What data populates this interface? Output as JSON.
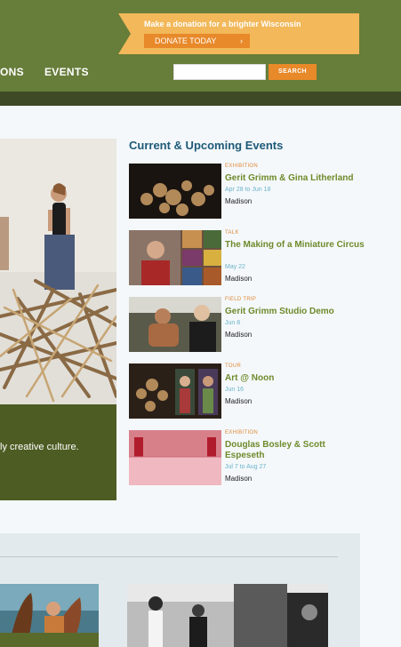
{
  "nav": {
    "items": [
      {
        "label": "ONS"
      },
      {
        "label": "EVENTS"
      }
    ]
  },
  "donate": {
    "message": "Make a donation for a brighter Wisconsin",
    "button_label": "DONATE TODAY",
    "chevron": "›"
  },
  "search": {
    "value": "",
    "button_label": "SEARCH"
  },
  "hero": {
    "caption": "ly creative culture."
  },
  "events_section": {
    "title": "Current & Upcoming Events",
    "items": [
      {
        "type": "EXHIBITION",
        "title": "Gerit Grimm & Gina Litherland",
        "date": "Apr 28 to Jun 18",
        "location": "Madison"
      },
      {
        "type": "TALK",
        "title": "The Making of a Miniature Circus",
        "date": "May 22",
        "location": "Madison"
      },
      {
        "type": "FIELD TRIP",
        "title": "Gerit Grimm Studio Demo",
        "date": "Jun 8",
        "location": "Madison"
      },
      {
        "type": "TOUR",
        "title": "Art @ Noon",
        "date": "Jun 16",
        "location": "Madison"
      },
      {
        "type": "EXHIBITION",
        "title": "Douglas Bosley & Scott Espeseth",
        "date": "Jul 7 to Aug 27",
        "location": "Madison"
      }
    ]
  },
  "colors": {
    "header_green": "#677d3a",
    "donate_orange": "#e8892a",
    "event_title_green": "#6f8a2a",
    "section_title_blue": "#1e5a78"
  }
}
